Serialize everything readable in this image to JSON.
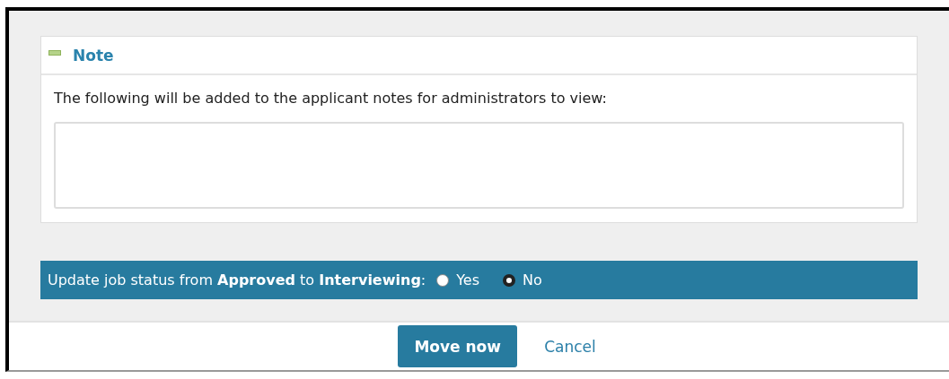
{
  "note_panel": {
    "title": "Note",
    "instruction": "The following will be added to the applicant notes for administrators to view:"
  },
  "status_bar": {
    "question": "Update job status from **Approved** to **Interviewing**:",
    "options": [
      {
        "label": "Yes",
        "selected": false
      },
      {
        "label": "No",
        "selected": true
      }
    ]
  },
  "buttons": [
    {
      "label": "Move now",
      "kind": "primary"
    },
    {
      "label": "Cancel",
      "kind": "link"
    }
  ]
}
